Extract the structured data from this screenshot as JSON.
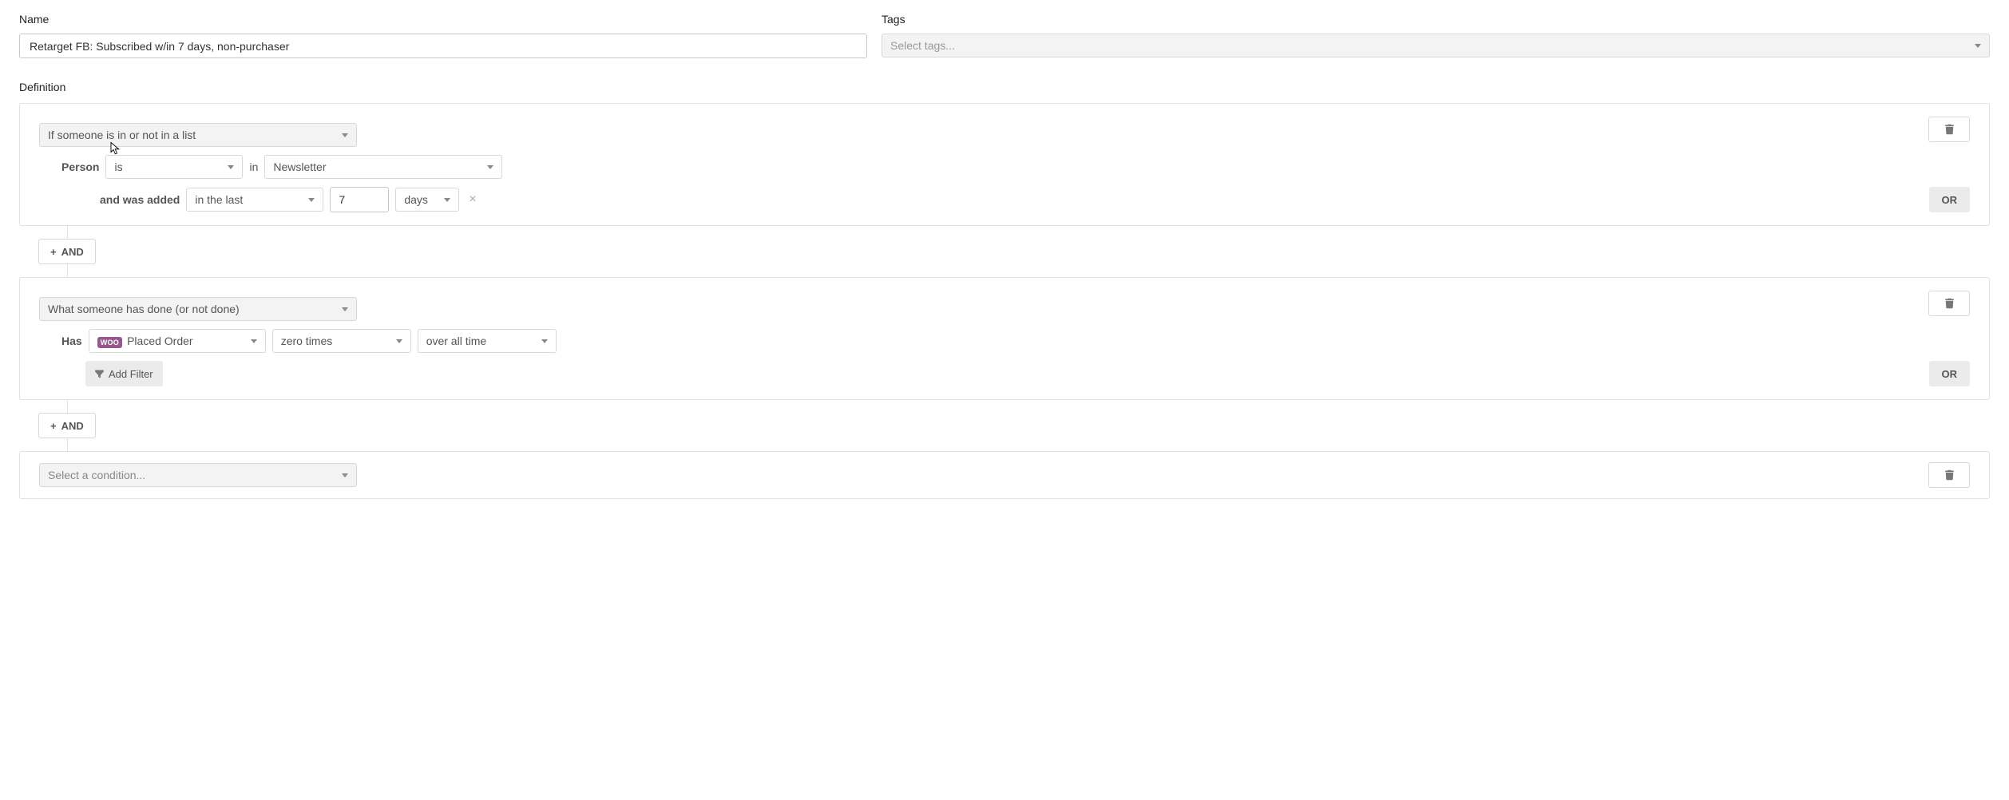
{
  "labels": {
    "name": "Name",
    "tags": "Tags",
    "definition": "Definition"
  },
  "name_value": "Retarget FB: Subscribed w/in 7 days, non-purchaser",
  "tags_placeholder": "Select tags...",
  "rule1": {
    "condition_type": "If someone is in or not in a list",
    "person_label": "Person",
    "is_value": "is",
    "in_label": "in",
    "list_value": "Newsletter",
    "added_label": "and was added",
    "timeframe": "in the last",
    "number": "7",
    "unit": "days",
    "or": "OR"
  },
  "and_label": "AND",
  "rule2": {
    "condition_type": "What someone has done (or not done)",
    "has_label": "Has",
    "event": "Placed Order",
    "woo_badge": "WOO",
    "count": "zero times",
    "range": "over all time",
    "add_filter": "Add Filter",
    "or": "OR"
  },
  "rule3": {
    "condition_placeholder": "Select a condition..."
  }
}
